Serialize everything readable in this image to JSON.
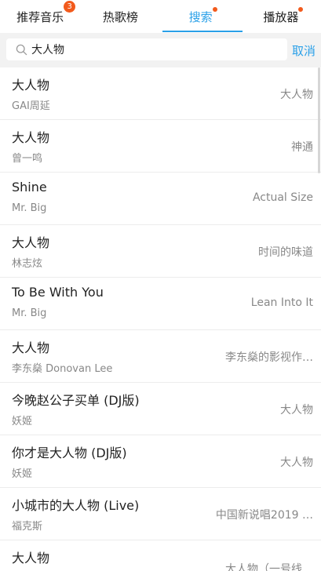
{
  "tabs": [
    {
      "label": "推荐音乐",
      "badge": "3",
      "dot": false,
      "active": false
    },
    {
      "label": "热歌榜",
      "badge": "",
      "dot": false,
      "active": false
    },
    {
      "label": "搜索",
      "badge": "",
      "dot": true,
      "active": true
    },
    {
      "label": "播放器",
      "badge": "",
      "dot": true,
      "active": false
    }
  ],
  "search": {
    "value": "大人物",
    "cancel_label": "取消"
  },
  "colors": {
    "accent": "#2aa0e8",
    "badge": "#f25a1c"
  },
  "results": [
    {
      "title": "大人物",
      "artist": "GAI周延",
      "album": "大人物"
    },
    {
      "title": "大人物",
      "artist": "曾一鸣",
      "album": "神通"
    },
    {
      "title": "Shine",
      "artist": "Mr. Big",
      "album": "Actual Size"
    },
    {
      "title": "大人物",
      "artist": "林志炫",
      "album": "时间的味道"
    },
    {
      "title": "To Be With You",
      "artist": "Mr. Big",
      "album": "Lean Into It"
    },
    {
      "title": "大人物",
      "artist": "李东燊 Donovan Lee",
      "album": "李东燊的影视作…"
    },
    {
      "title": "今晚赵公子买单 (DJ版)",
      "artist": "妖姬",
      "album": "大人物"
    },
    {
      "title": "你才是大人物 (DJ版)",
      "artist": "妖姬",
      "album": "大人物"
    },
    {
      "title": "小城市的大人物 (Live)",
      "artist": "福克斯",
      "album": "中国新说唱2019 …"
    },
    {
      "title": "大人物",
      "artist": "",
      "album": "大人物（一号线…"
    }
  ]
}
